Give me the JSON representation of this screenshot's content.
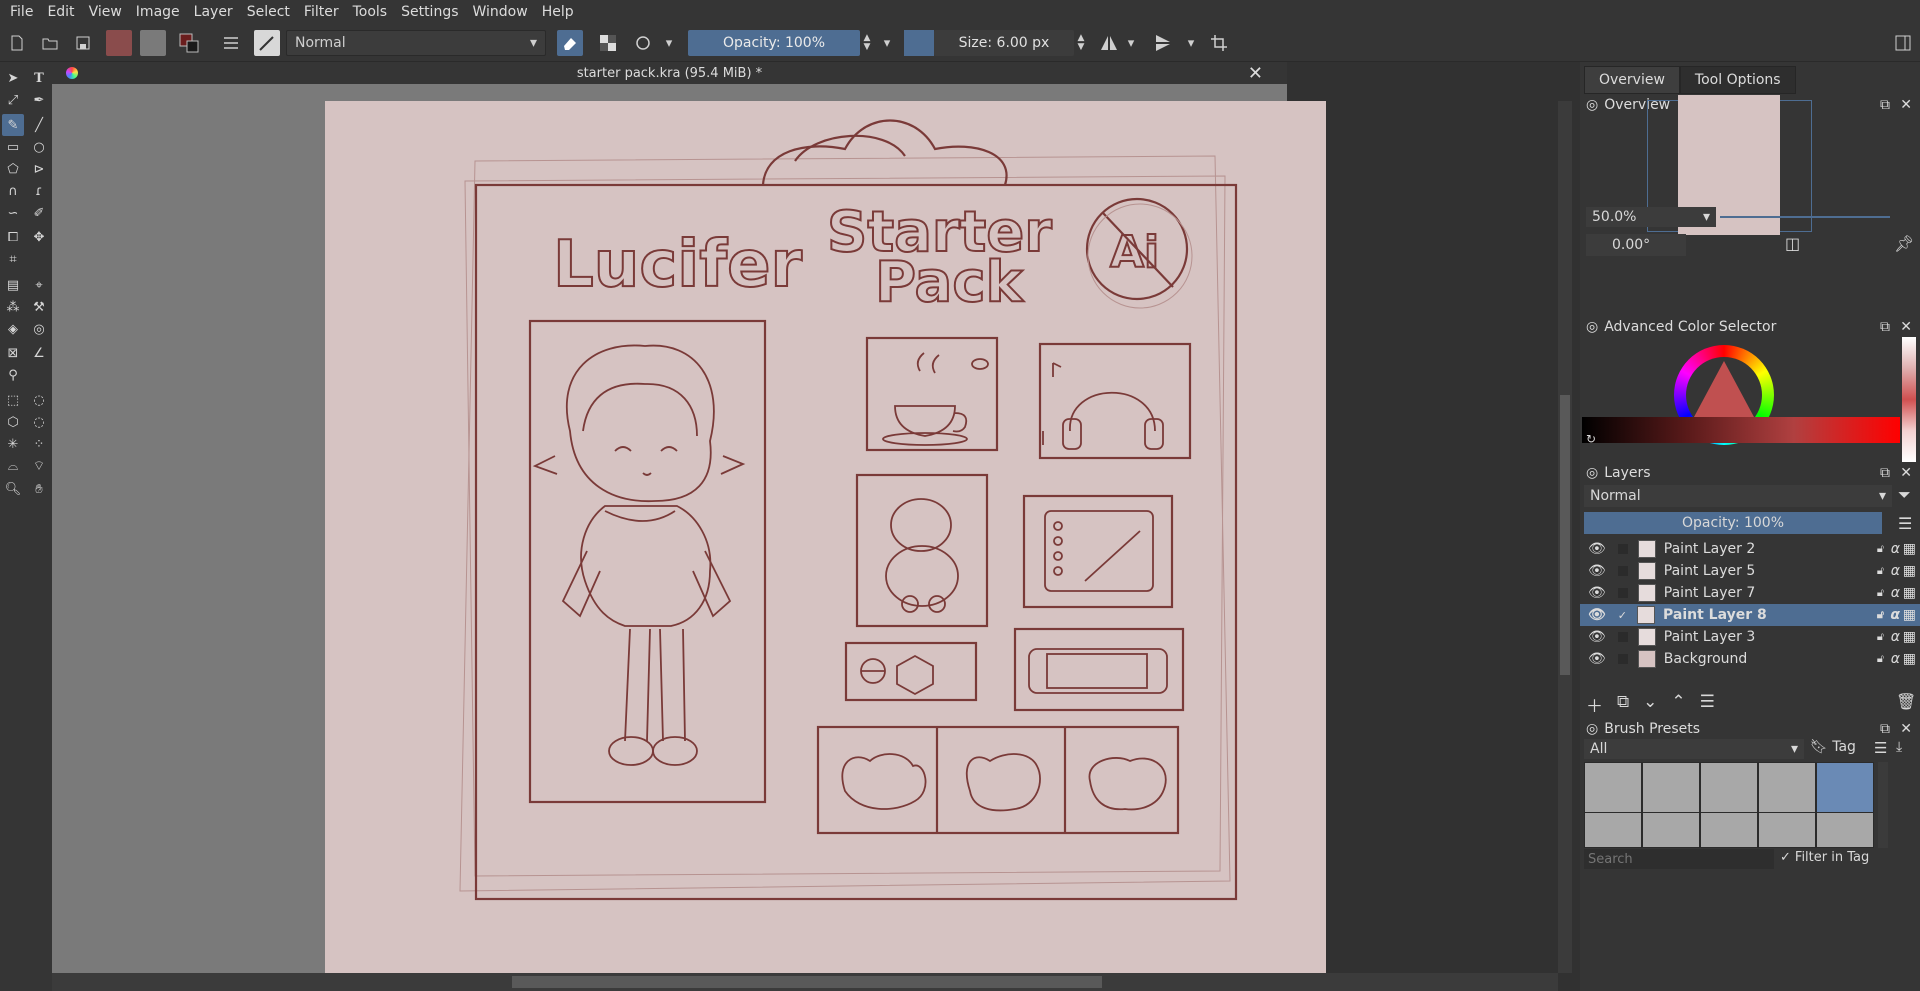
{
  "menu": [
    "File",
    "Edit",
    "View",
    "Image",
    "Layer",
    "Select",
    "Filter",
    "Tools",
    "Settings",
    "Window",
    "Help"
  ],
  "toolbar": {
    "blend_mode": "Normal",
    "opacity": "Opacity: 100%",
    "size": "Size: 6.00 px"
  },
  "document": {
    "title": "starter pack.kra (95.4 MiB) *"
  },
  "canvas": {
    "name_lettering": "Lucifer",
    "title_line1": "Starter",
    "title_line2": "Pack",
    "badge_text": "Ai"
  },
  "docker_tabs": [
    "Overview",
    "Tool Options"
  ],
  "overview": {
    "title": "Overview",
    "zoom": "50.0%",
    "rotation": "0.00°"
  },
  "color_selector": {
    "title": "Advanced Color Selector"
  },
  "layers": {
    "title": "Layers",
    "blend_mode": "Normal",
    "opacity": "Opacity:  100%",
    "items": [
      {
        "name": "Paint Layer 2",
        "selected": false
      },
      {
        "name": "Paint Layer 5",
        "selected": false
      },
      {
        "name": "Paint Layer 7",
        "selected": false
      },
      {
        "name": "Paint Layer 8",
        "selected": true
      },
      {
        "name": "Paint Layer 3",
        "selected": false
      },
      {
        "name": "Background",
        "selected": false
      }
    ]
  },
  "brush_presets": {
    "title": "Brush Presets",
    "filter": "All",
    "tag": "Tag",
    "search_placeholder": "Search",
    "filter_in_tag": "Filter in Tag"
  },
  "colors": {
    "accent": "#4e6d92",
    "canvas_bg": "#d6c3c2",
    "sketch": "#7a3a38"
  }
}
